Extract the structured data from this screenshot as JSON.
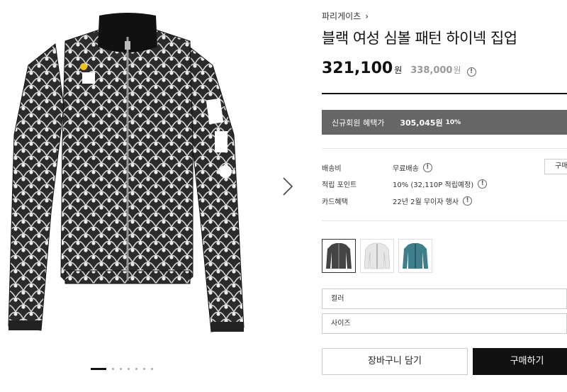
{
  "brand": {
    "name": "파리게이츠",
    "chevron": "›"
  },
  "product": {
    "title": "블랙 여성 심볼 패턴 하이넥 집업",
    "price": "321,100",
    "price_unit": "원",
    "original_price": "338,000",
    "original_unit": "원"
  },
  "member_benefit": {
    "label": "신규회원 혜택가",
    "price": "305,045원",
    "percent": "10%"
  },
  "meta": [
    {
      "key": "배송비",
      "value": "무료배송",
      "info": true
    },
    {
      "key": "적립 포인트",
      "value": "10% (32,110P 적립예정)",
      "info": true
    },
    {
      "key": "카드혜택",
      "value": "22년 2월 무이자 행사",
      "info": true
    }
  ],
  "side_buy_label": "구매하기",
  "swatches": [
    {
      "name": "black",
      "color": "#3a3a3a"
    },
    {
      "name": "white",
      "color": "#e8e8e8"
    },
    {
      "name": "teal",
      "color": "#3f7f8c"
    }
  ],
  "options": {
    "color_label": "컬러",
    "size_label": "사이즈"
  },
  "actions": {
    "cart": "장바구니 담기",
    "buy": "구매하기"
  },
  "gallery": {
    "slide_count": 7,
    "active": 0
  }
}
